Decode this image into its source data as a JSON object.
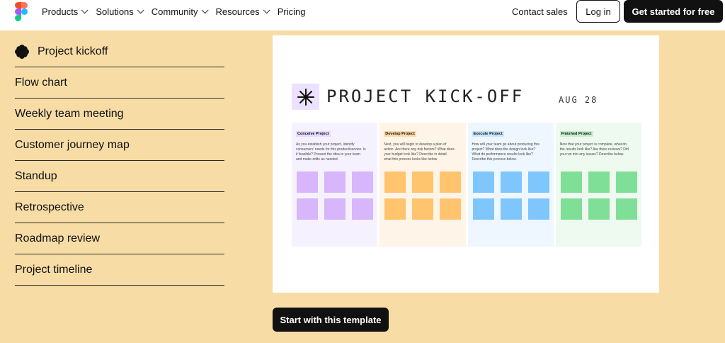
{
  "nav": {
    "items": [
      {
        "label": "Products"
      },
      {
        "label": "Solutions"
      },
      {
        "label": "Community"
      },
      {
        "label": "Resources"
      },
      {
        "label": "Pricing"
      }
    ],
    "contact": "Contact sales",
    "login": "Log in",
    "get_started": "Get started for free"
  },
  "templates": [
    {
      "label": "Project kickoff"
    },
    {
      "label": "Flow chart"
    },
    {
      "label": "Weekly team meeting"
    },
    {
      "label": "Customer journey map"
    },
    {
      "label": "Standup"
    },
    {
      "label": "Retrospective"
    },
    {
      "label": "Roadmap review"
    },
    {
      "label": "Project timeline"
    }
  ],
  "preview": {
    "title": "PROJECT KICK-OFF",
    "date": "AUG 28",
    "columns": [
      {
        "tag": "Conceive Project",
        "text": "As you establish your project, identify consumers' needs for this product/service. Is it feasible? Present the idea to your team and make edits as needed.",
        "bg": "#f6f1ff",
        "tag_bg": "#e6dbff",
        "note": "#d7b6fb"
      },
      {
        "tag": "Develop Project",
        "text": "Next, you will begin to develop a plan of action. Are there any risk factors? What does your budget look like? Describe in detail what this process looks like below",
        "bg": "#fff4e8",
        "tag_bg": "#ffd9a8",
        "note": "#ffc46d"
      },
      {
        "tag": "Execute Project",
        "text": "How will your team go about producing this project? What does the design look like? What do performance results look like? Describe this process below.",
        "bg": "#eef7ff",
        "tag_bg": "#c8e6fb",
        "note": "#7ec6fb"
      },
      {
        "tag": "Finished Project",
        "text": "Now that your project is complete, what do the results look like? Are there reviews? Did you run into any issues? Describe below.",
        "bg": "#eefaf0",
        "tag_bg": "#c8efce",
        "note": "#7fdf97"
      }
    ]
  },
  "cta": "Start with this template"
}
